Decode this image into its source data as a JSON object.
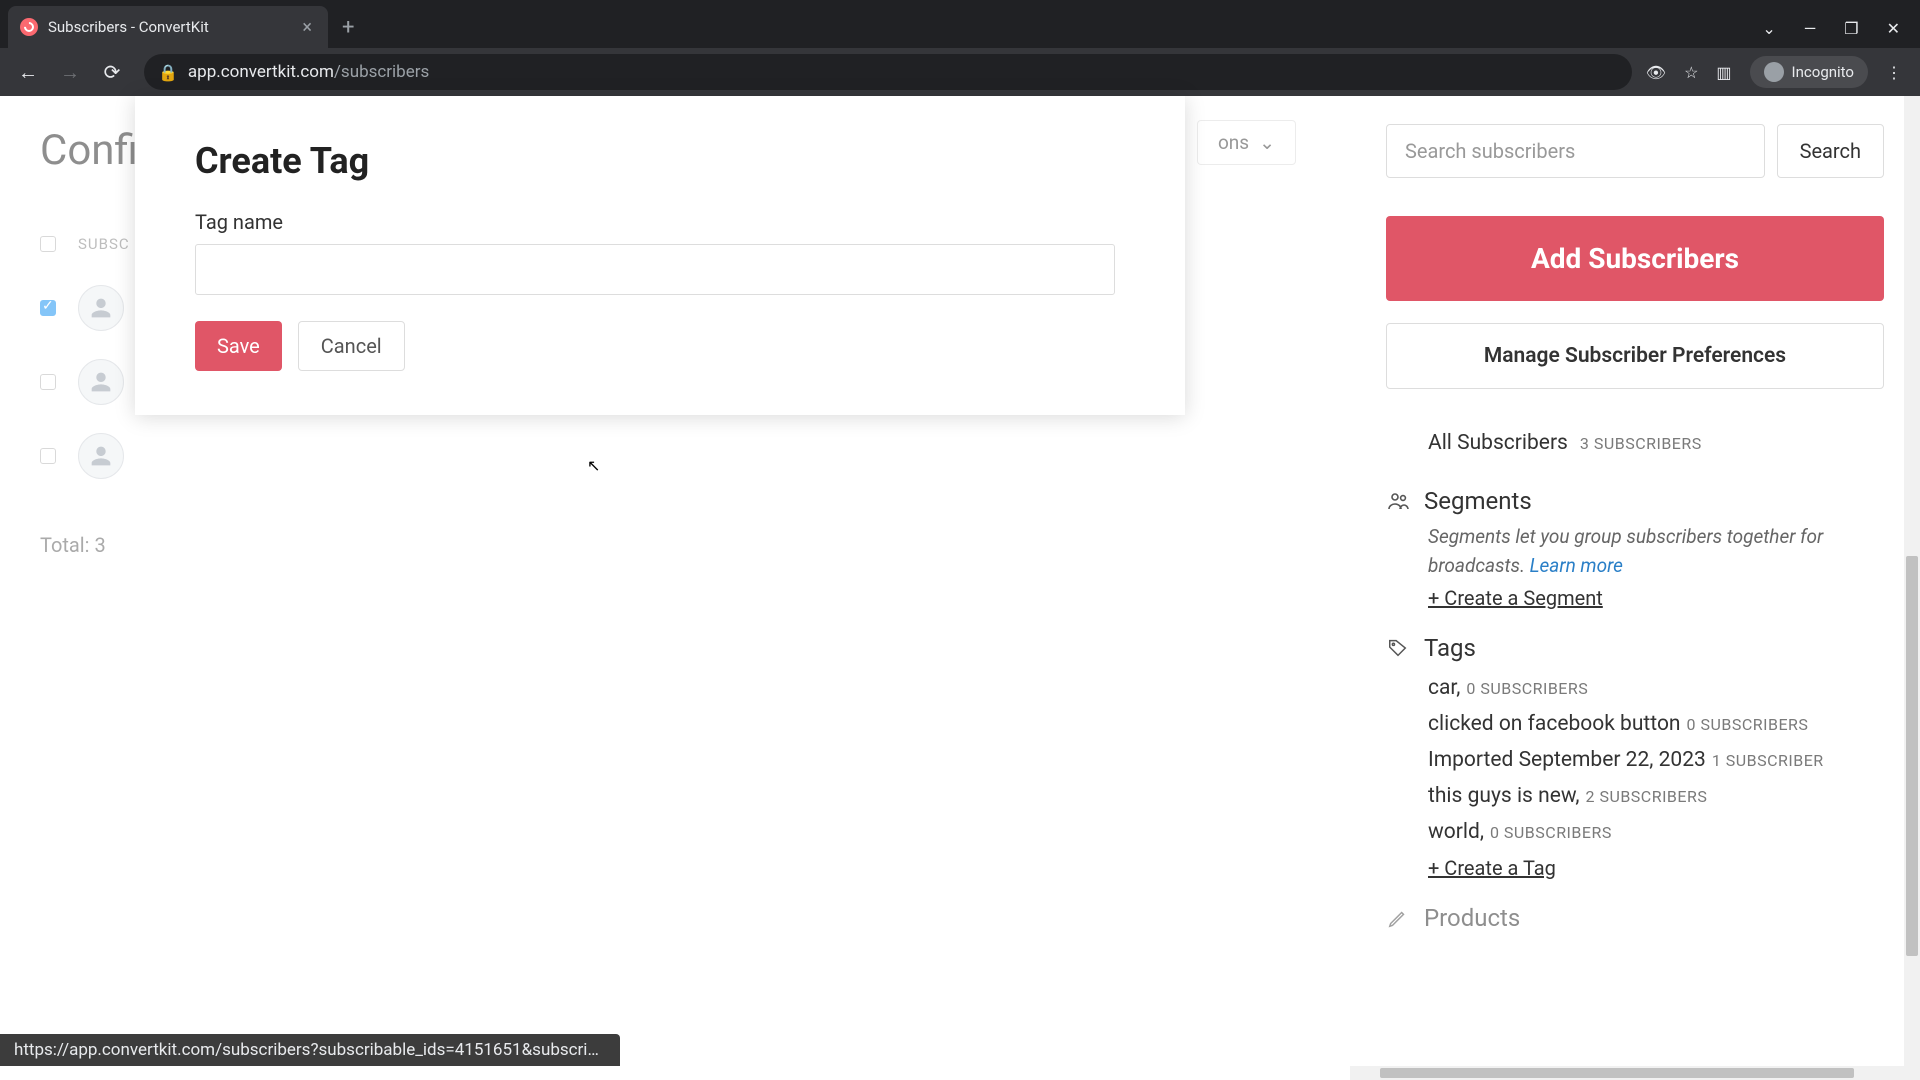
{
  "browser": {
    "tab_title": "Subscribers - ConvertKit",
    "url_domain": "app.convertkit.com",
    "url_path": "/subscribers",
    "incognito_label": "Incognito"
  },
  "main": {
    "title_visible_prefix": "Confi",
    "col_header": "SUBSC",
    "bulk_actions_suffix": "ons",
    "total_label": "Total: 3",
    "rows": [
      {
        "checked": true
      },
      {
        "checked": false
      },
      {
        "checked": false
      }
    ]
  },
  "modal": {
    "title": "Create Tag",
    "label": "Tag name",
    "value": "",
    "save": "Save",
    "cancel": "Cancel"
  },
  "rail": {
    "search_placeholder": "Search subscribers",
    "search_button": "Search",
    "add_button": "Add Subscribers",
    "manage_button": "Manage Subscriber Preferences",
    "all_subs_label": "All Subscribers",
    "all_subs_meta": "3 SUBSCRIBERS",
    "segments": {
      "heading": "Segments",
      "desc_1": "Segments let you group subscribers together for broadcasts. ",
      "learn_more": "Learn more",
      "create": "+ Create a Segment"
    },
    "tags": {
      "heading": "Tags",
      "items": [
        {
          "name": "car,",
          "meta": "0 SUBSCRIBERS"
        },
        {
          "name": "clicked on facebook button",
          "meta": "0 SUBSCRIBERS"
        },
        {
          "name": "Imported September 22, 2023",
          "meta": "1 SUBSCRIBER"
        },
        {
          "name": "this guys is new,",
          "meta": "2 SUBSCRIBERS"
        },
        {
          "name": "world,",
          "meta": "0 SUBSCRIBERS"
        }
      ],
      "create": "+ Create a Tag"
    },
    "products_heading": "Products"
  },
  "status_url": "https://app.convertkit.com/subscribers?subscribable_ids=4151651&subscrib…"
}
